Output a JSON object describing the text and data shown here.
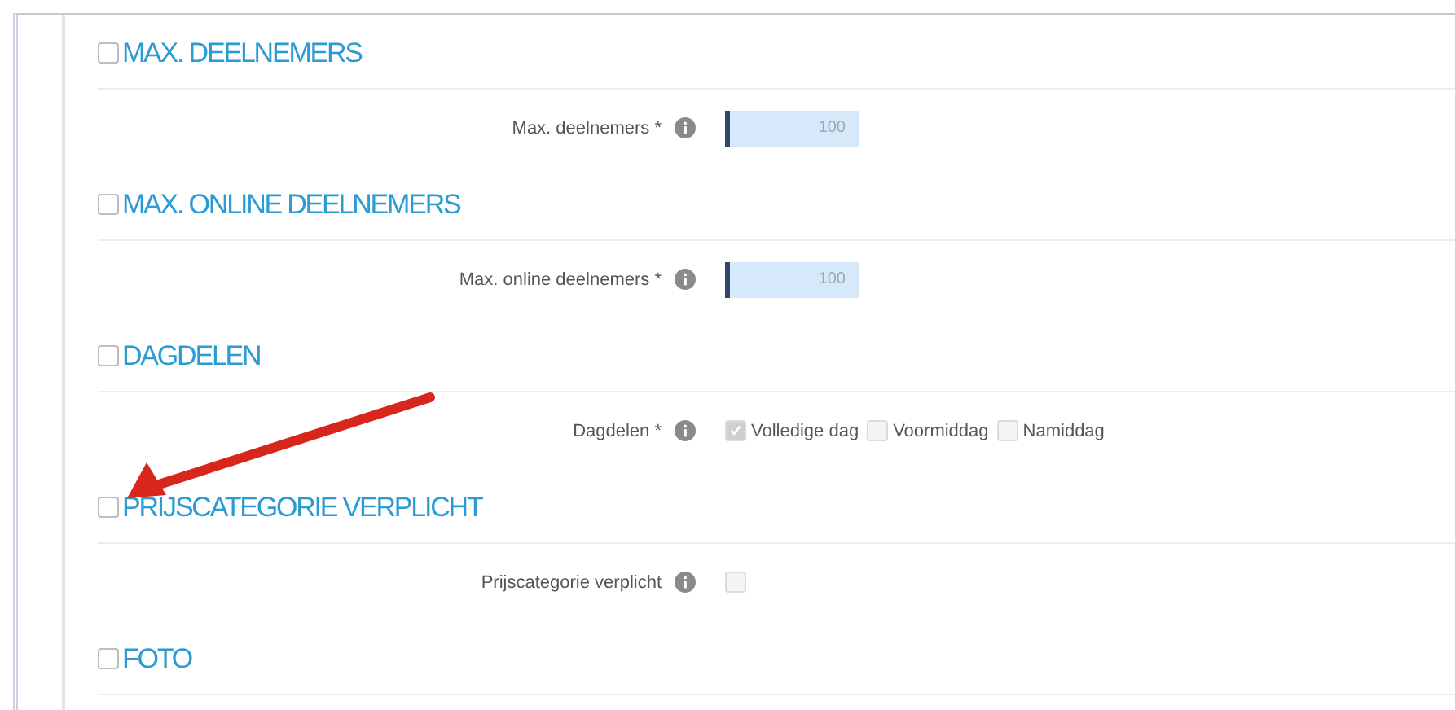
{
  "sections": [
    {
      "title": "MAX. DEELNEMERS",
      "checked": false,
      "field": {
        "kind": "number",
        "label": "Max. deelnemers *",
        "value": "100"
      }
    },
    {
      "title": "MAX. ONLINE DEELNEMERS",
      "checked": false,
      "field": {
        "kind": "number",
        "label": "Max. online deelnemers *",
        "value": "100"
      }
    },
    {
      "title": "DAGDELEN",
      "checked": false,
      "field": {
        "kind": "checkboxes",
        "label": "Dagdelen *",
        "options": [
          {
            "label": "Volledige dag",
            "checked": true
          },
          {
            "label": "Voormiddag",
            "checked": false
          },
          {
            "label": "Namiddag",
            "checked": false
          }
        ]
      }
    },
    {
      "title": "PRIJSCATEGORIE VERPLICHT",
      "checked": false,
      "arrow": true,
      "field": {
        "kind": "checkbox",
        "label": "Prijscategorie verplicht",
        "checked": false
      }
    },
    {
      "title": "FOTO",
      "checked": false
    }
  ]
}
